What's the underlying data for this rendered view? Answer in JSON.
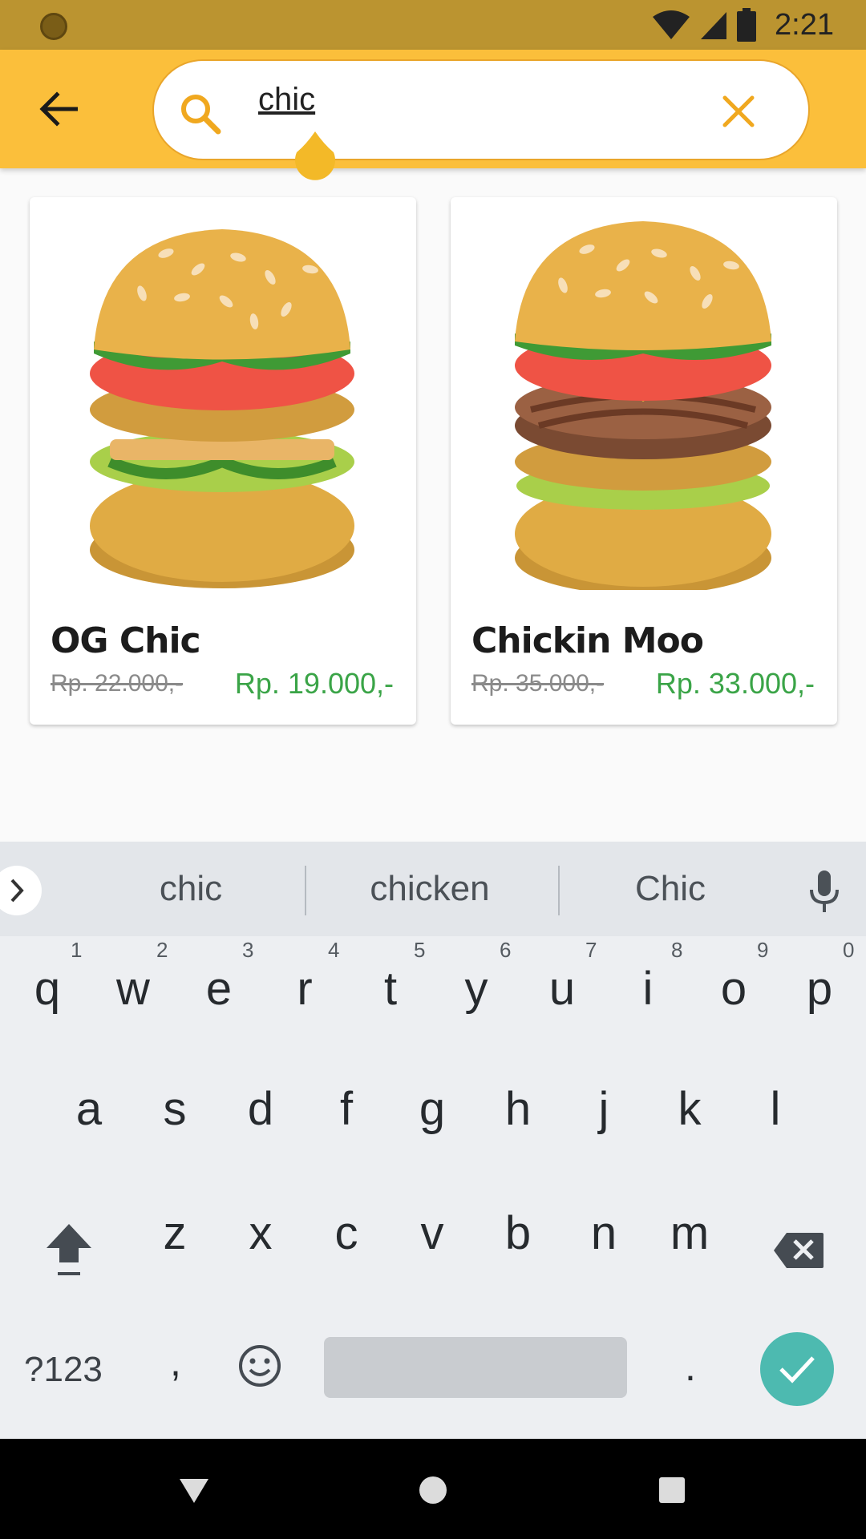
{
  "status_bar": {
    "time": "2:21",
    "icons": [
      "wifi-icon",
      "signal-icon",
      "battery-icon"
    ]
  },
  "search": {
    "query": "chic",
    "icon": "search-icon",
    "clear_icon": "close-icon"
  },
  "products": [
    {
      "name": "OG Chic",
      "old_price": "Rp. 22.000,-",
      "new_price": "Rp. 19.000,-"
    },
    {
      "name": "Chickin Moo",
      "old_price": "Rp. 35.000,-",
      "new_price": "Rp. 33.000,-"
    }
  ],
  "keyboard": {
    "suggestions": [
      "chic",
      "chicken",
      "Chic"
    ],
    "row1": [
      "q",
      "w",
      "e",
      "r",
      "t",
      "y",
      "u",
      "i",
      "o",
      "p"
    ],
    "row1_hints": [
      "1",
      "2",
      "3",
      "4",
      "5",
      "6",
      "7",
      "8",
      "9",
      "0"
    ],
    "row2": [
      "a",
      "s",
      "d",
      "f",
      "g",
      "h",
      "j",
      "k",
      "l"
    ],
    "row3": [
      "z",
      "x",
      "c",
      "v",
      "b",
      "n",
      "m"
    ],
    "symbols_label": "?123",
    "comma": ",",
    "period": "."
  },
  "colors": {
    "app_bar": "#fbbf3b",
    "status_bar": "#bb9430",
    "price_green": "#3aa447",
    "enter_key": "#4dbab0"
  }
}
